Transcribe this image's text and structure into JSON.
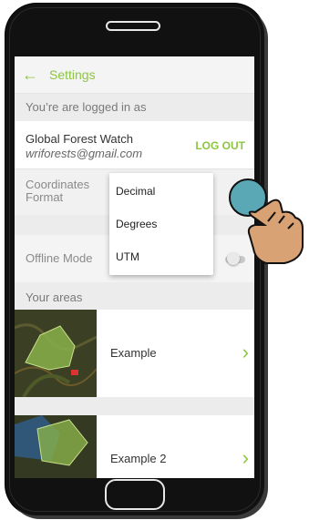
{
  "header": {
    "title": "Settings"
  },
  "account": {
    "section_label": "You’re are logged in as",
    "name": "Global Forest Watch",
    "email": "wriforests@gmail.com",
    "logout_label": "LOG OUT"
  },
  "coordinates": {
    "label_line1": "Coordinates",
    "label_line2": "Format",
    "options": [
      "Decimal",
      "Degrees",
      "UTM"
    ]
  },
  "offline": {
    "label": "Offline Mode",
    "enabled": false
  },
  "areas": {
    "section_label": "Your areas",
    "items": [
      {
        "name": "Example"
      },
      {
        "name": "Example 2"
      }
    ]
  },
  "colors": {
    "accent": "#8cc63f",
    "screen_bg": "#ececec",
    "phone_body": "#111111"
  }
}
